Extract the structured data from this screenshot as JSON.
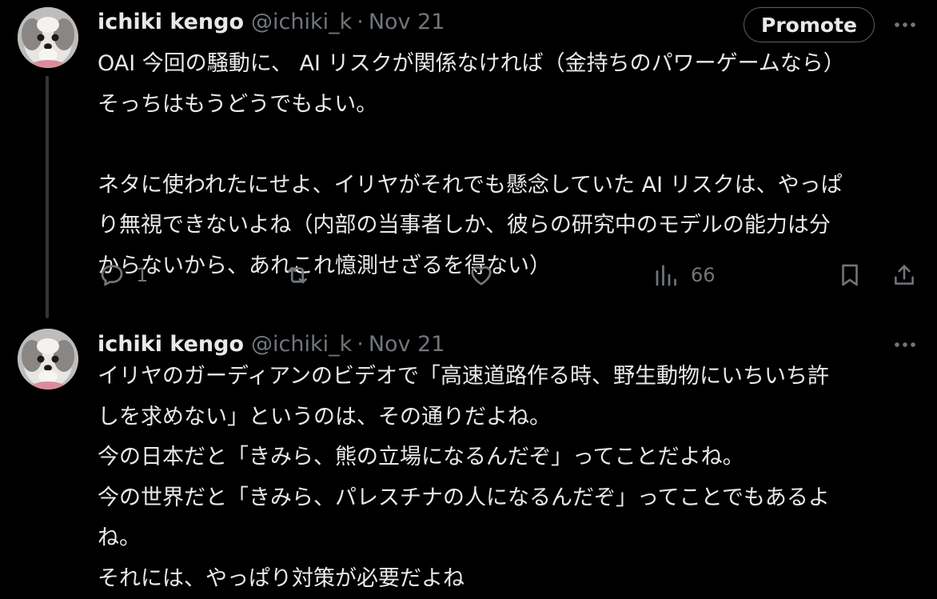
{
  "tweets": [
    {
      "author": {
        "display_name": "ichiki kengo",
        "handle": "@ichiki_k"
      },
      "separator": "·",
      "date": "Nov 21",
      "promote_label": "Promote",
      "lines": [
        "OAI 今回の騒動に、 AI リスクが関係なければ（金持ちのパワーゲームなら）",
        "そっちはもうどうでもよい。",
        "",
        "ネタに使われたにせよ、イリヤがそれでも懸念していた AI リスクは、やっぱ",
        "り無視できないよね（内部の当事者しか、彼らの研究中のモデルの能力は分",
        "からないから、あれこれ憶測せざるを得ない）"
      ],
      "actions": {
        "replies": "1",
        "views": "66"
      }
    },
    {
      "author": {
        "display_name": "ichiki kengo",
        "handle": "@ichiki_k"
      },
      "separator": "·",
      "date": "Nov 21",
      "lines": [
        "イリヤのガーディアンのビデオで「高速道路作る時、野生動物にいちいち許",
        "しを求めない」というのは、その通りだよね。",
        "今の日本だと「きみら、熊の立場になるんだぞ」ってことだよね。",
        "今の世界だと「きみら、パレスチナの人になるんだぞ」ってことでもあるよ",
        "ね。",
        "それには、やっぱり対策が必要だよね"
      ]
    }
  ],
  "icons": {
    "reply": "reply-icon",
    "retweet": "retweet-icon",
    "like": "heart-icon",
    "views": "views-icon",
    "bookmark": "bookmark-icon",
    "share": "share-icon",
    "more": "more-icon"
  },
  "colors": {
    "background": "#000000",
    "text_primary": "#e7e9ea",
    "text_secondary": "#71767b",
    "border": "#536471",
    "thread_line": "#333639"
  }
}
